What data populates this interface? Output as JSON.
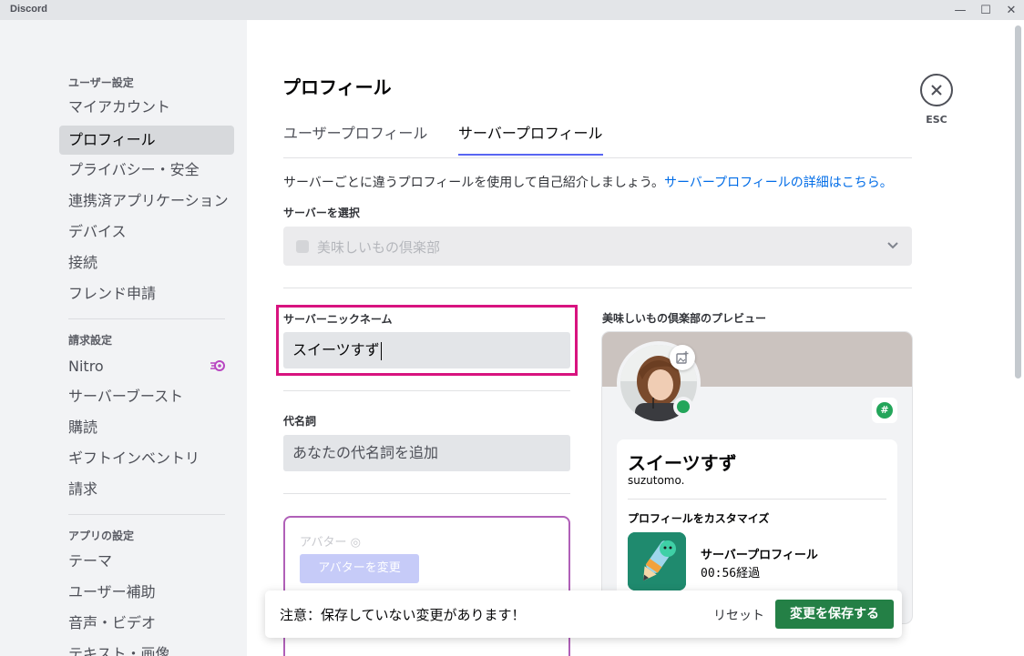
{
  "window": {
    "app_name": "Discord",
    "minimize": "—",
    "maximize": "☐",
    "close": "✕"
  },
  "sidebar": {
    "sections": [
      {
        "header": "ユーザー設定",
        "items": [
          "マイアカウント",
          "プロフィール",
          "プライバシー・安全",
          "連携済アプリケーション",
          "デバイス",
          "接続",
          "フレンド申請"
        ]
      },
      {
        "header": "請求設定",
        "items": [
          "Nitro",
          "サーバーブースト",
          "購読",
          "ギフトインベントリ",
          "請求"
        ]
      },
      {
        "header": "アプリの設定",
        "items": [
          "テーマ",
          "ユーザー補助",
          "音声・ビデオ",
          "テキスト・画像"
        ]
      }
    ],
    "selected": "プロフィール"
  },
  "main": {
    "title": "プロフィール",
    "tabs": [
      "ユーザープロフィール",
      "サーバープロフィール"
    ],
    "active_tab": "サーバープロフィール",
    "intro_text": "サーバーごとに違うプロフィールを使用して自己紹介しましょう。",
    "intro_link": "サーバープロフィールの詳細はこちら。",
    "server_select": {
      "label": "サーバーを選択",
      "value": "美味しいもの倶楽部"
    },
    "nickname": {
      "label": "サーバーニックネーム",
      "value": "スイーツすず"
    },
    "pronouns": {
      "label": "代名詞",
      "placeholder": "あなたの代名詞を追加"
    },
    "avatar": {
      "label": "アバター",
      "button": "アバターを変更"
    }
  },
  "preview": {
    "label": "美味しいもの倶楽部のプレビュー",
    "display_name": "スイーツすず",
    "username": "suzutomo.",
    "customize_title": "プロフィールをカスタマイズ",
    "activity_title": "サーバープロフィール",
    "activity_time": "00:56経過",
    "banner_color": "#cbc3bf",
    "status_color": "#23a55a"
  },
  "close": {
    "label": "ESC"
  },
  "notice": {
    "text": "注意：保存していない変更があります！",
    "reset": "リセット",
    "save": "変更を保存する"
  },
  "colors": {
    "accent": "#5865f2",
    "highlight": "#d8137f",
    "save": "#248046",
    "link": "#006ce7"
  }
}
